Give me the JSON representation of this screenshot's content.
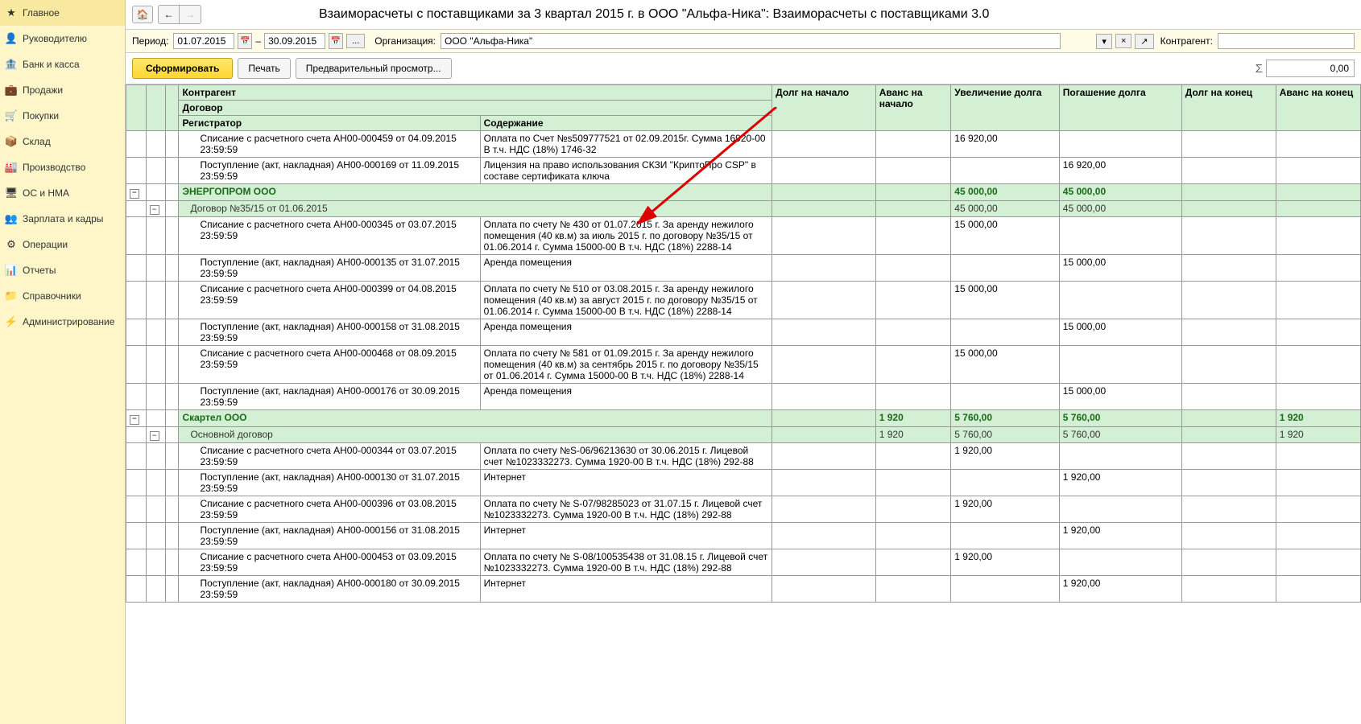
{
  "sidebar": {
    "items": [
      {
        "icon": "★",
        "label": "Главное"
      },
      {
        "icon": "👤",
        "label": "Руководителю"
      },
      {
        "icon": "🏦",
        "label": "Банк и касса"
      },
      {
        "icon": "💼",
        "label": "Продажи"
      },
      {
        "icon": "🛒",
        "label": "Покупки"
      },
      {
        "icon": "📦",
        "label": "Склад"
      },
      {
        "icon": "🏭",
        "label": "Производство"
      },
      {
        "icon": "🖥",
        "label": "ОС и НМА"
      },
      {
        "icon": "👥",
        "label": "Зарплата и кадры"
      },
      {
        "icon": "⚙",
        "label": "Операции"
      },
      {
        "icon": "📊",
        "label": "Отчеты"
      },
      {
        "icon": "📁",
        "label": "Справочники"
      },
      {
        "icon": "⚡",
        "label": "Администрирование"
      }
    ]
  },
  "header": {
    "title": "Взаиморасчеты с поставщиками за 3 квартал 2015 г. в ООО \"Альфа-Ника\": Взаиморасчеты с поставщиками 3.0"
  },
  "filter": {
    "period_label": "Период:",
    "date_from": "01.07.2015",
    "date_to": "30.09.2015",
    "dash": "–",
    "dots": "...",
    "org_label": "Организация:",
    "org_value": "ООО \"Альфа-Ника\"",
    "contr_label": "Контрагент:"
  },
  "actions": {
    "form": "Сформировать",
    "print": "Печать",
    "preview": "Предварительный просмотр...",
    "sigma": "Σ",
    "sum_value": "0,00"
  },
  "columns": {
    "c1": "Контрагент",
    "c1b": "Договор",
    "c1c": "Регистратор",
    "c1d": "Содержание",
    "c2": "Долг на начало",
    "c3": "Аванс на начало",
    "c4": "Увеличение долга",
    "c5": "Погашение долга",
    "c6": "Долг на конец",
    "c7": "Аванс на конец"
  },
  "rows": [
    {
      "type": "detail",
      "reg": "Списание с расчетного счета АН00-000459 от 04.09.2015 23:59:59",
      "desc": "Оплата по Счет №s509777521 от 02.09.2015г. Сумма 16920-00 В т.ч. НДС  (18%) 1746-32",
      "v4": "16 920,00"
    },
    {
      "type": "detail",
      "reg": "Поступление (акт, накладная) АН00-000169 от 11.09.2015 23:59:59",
      "desc": "Лицензия на право использования СКЗИ \"КриптоПро CSP\" в составе сертификата ключа",
      "v5": "16 920,00"
    },
    {
      "type": "group1",
      "reg": "ЭНЕРГОПРОМ ООО",
      "v4": "45 000,00",
      "v5": "45 000,00"
    },
    {
      "type": "group2",
      "reg": "Договор №35/15 от 01.06.2015",
      "v4": "45 000,00",
      "v5": "45 000,00"
    },
    {
      "type": "detail",
      "reg": "Списание с расчетного счета АН00-000345 от 03.07.2015 23:59:59",
      "desc": "Оплата по счету № 430 от 01.07.2015 г. За аренду нежилого помещения (40 кв.м) за июль 2015 г. по договору №35/15 от 01.06.2014 г. Сумма 15000-00 В т.ч. НДС  (18%) 2288-14",
      "v4": "15 000,00"
    },
    {
      "type": "detail",
      "reg": "Поступление (акт, накладная) АН00-000135 от 31.07.2015 23:59:59",
      "desc": "Аренда помещения",
      "v5": "15 000,00"
    },
    {
      "type": "detail",
      "reg": "Списание с расчетного счета АН00-000399 от 04.08.2015 23:59:59",
      "desc": "Оплата по счету № 510 от 03.08.2015 г. За аренду нежилого помещения (40 кв.м) за август 2015 г. по договору №35/15 от 01.06.2014 г. Сумма 15000-00 В т.ч. НДС  (18%) 2288-14",
      "v4": "15 000,00"
    },
    {
      "type": "detail",
      "reg": "Поступление (акт, накладная) АН00-000158 от 31.08.2015 23:59:59",
      "desc": "Аренда помещения",
      "v5": "15 000,00"
    },
    {
      "type": "detail",
      "reg": "Списание с расчетного счета АН00-000468 от 08.09.2015 23:59:59",
      "desc": "Оплата по счету № 581 от 01.09.2015 г. За аренду нежилого помещения (40 кв.м) за сентябрь 2015 г. по договору №35/15 от 01.06.2014 г. Сумма 15000-00 В т.ч. НДС  (18%) 2288-14",
      "v4": "15 000,00"
    },
    {
      "type": "detail",
      "reg": "Поступление (акт, накладная) АН00-000176 от 30.09.2015 23:59:59",
      "desc": "Аренда помещения",
      "v5": "15 000,00"
    },
    {
      "type": "group1",
      "reg": "Скартел ООО",
      "v3": "1 920",
      "v4": "5 760,00",
      "v5": "5 760,00",
      "v7": "1 920"
    },
    {
      "type": "group2",
      "reg": "Основной договор",
      "v3": "1 920",
      "v4": "5 760,00",
      "v5": "5 760,00",
      "v7": "1 920"
    },
    {
      "type": "detail",
      "reg": "Списание с расчетного счета АН00-000344 от 03.07.2015 23:59:59",
      "desc": "Оплата по счету №S-06/96213630 от 30.06.2015 г. Лицевой счет №1023332273. Сумма 1920-00 В т.ч. НДС (18%) 292-88",
      "v4": "1 920,00"
    },
    {
      "type": "detail",
      "reg": "Поступление (акт, накладная) АН00-000130 от 31.07.2015 23:59:59",
      "desc": "Интернет",
      "v5": "1 920,00"
    },
    {
      "type": "detail",
      "reg": "Списание с расчетного счета АН00-000396 от 03.08.2015 23:59:59",
      "desc": "Оплата по счету № S-07/98285023 от 31.07.15 г. Лицевой счет №1023332273. Сумма 1920-00 В т.ч. НДС (18%) 292-88",
      "v4": "1 920,00"
    },
    {
      "type": "detail",
      "reg": "Поступление (акт, накладная) АН00-000156 от 31.08.2015 23:59:59",
      "desc": "Интернет",
      "v5": "1 920,00"
    },
    {
      "type": "detail",
      "reg": "Списание с расчетного счета АН00-000453 от 03.09.2015 23:59:59",
      "desc": "Оплата по счету № S-08/100535438 от 31.08.15 г. Лицевой счет №1023332273. Сумма 1920-00 В т.ч. НДС (18%) 292-88",
      "v4": "1 920,00"
    },
    {
      "type": "detail",
      "reg": "Поступление (акт, накладная) АН00-000180 от 30.09.2015 23:59:59",
      "desc": "Интернет",
      "v5": "1 920,00"
    }
  ]
}
